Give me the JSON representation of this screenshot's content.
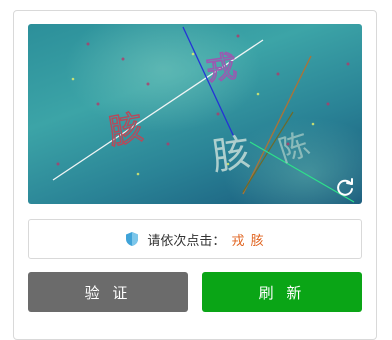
{
  "prompt": {
    "label": "请依次点击：",
    "chars": "戎 胲"
  },
  "captcha": {
    "glyphs": [
      "戎",
      "胲",
      "胲",
      "陈"
    ]
  },
  "buttons": {
    "verify_label": "验 证",
    "refresh_label": "刷 新"
  },
  "colors": {
    "verify_button": "#6b6b6b",
    "refresh_button": "#0aa516",
    "highlight_text": "#e0621d"
  },
  "icons": {
    "refresh": "refresh-icon",
    "shield": "shield-icon"
  }
}
